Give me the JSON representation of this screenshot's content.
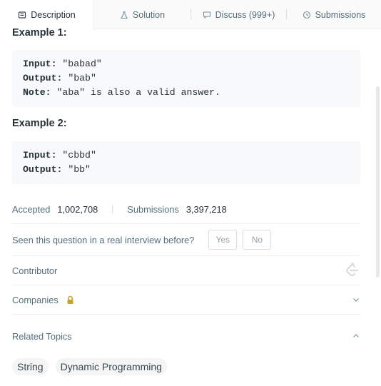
{
  "tabs": [
    {
      "label": "Description",
      "icon": "document-icon"
    },
    {
      "label": "Solution",
      "icon": "flask-icon"
    },
    {
      "label": "Discuss (999+)",
      "icon": "comment-icon"
    },
    {
      "label": "Submissions",
      "icon": "clock-icon"
    }
  ],
  "examples": [
    {
      "title": "Example 1:",
      "lines": [
        {
          "key": "Input:",
          "value": " \"babad\""
        },
        {
          "key": "Output:",
          "value": " \"bab\""
        },
        {
          "key": "Note:",
          "value": " \"aba\" is also a valid answer."
        }
      ]
    },
    {
      "title": "Example 2:",
      "lines": [
        {
          "key": "Input:",
          "value": " \"cbbd\""
        },
        {
          "key": "Output:",
          "value": " \"bb\""
        }
      ]
    }
  ],
  "stats": {
    "accepted_label": "Accepted",
    "accepted_value": "1,002,708",
    "submissions_label": "Submissions",
    "submissions_value": "3,397,218"
  },
  "interview": {
    "question": "Seen this question in a real interview before?",
    "yes": "Yes",
    "no": "No"
  },
  "contributor": {
    "label": "Contributor",
    "icon": "leetcode-logo-icon"
  },
  "companies": {
    "label": "Companies",
    "icon": "lock-icon",
    "toggle_icon": "chevron-down-icon"
  },
  "related": {
    "label": "Related Topics",
    "toggle_icon": "chevron-up-icon",
    "tags": [
      "String",
      "Dynamic Programming"
    ]
  },
  "colors": {
    "lock": "#c9a227",
    "text": "#263238",
    "muted": "#546e7a",
    "code_bg": "#f7f9fa"
  }
}
